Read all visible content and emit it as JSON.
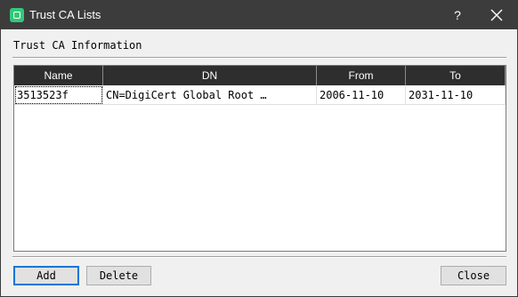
{
  "window": {
    "title": "Trust CA Lists",
    "help_label": "?"
  },
  "section": {
    "label": "Trust CA Information"
  },
  "table": {
    "columns": [
      "Name",
      "DN",
      "From",
      "To"
    ],
    "rows": [
      [
        "3513523f",
        "CN=DigiCert Global Root …",
        "2006-11-10",
        "2031-11-10"
      ]
    ]
  },
  "buttons": {
    "add": "Add",
    "delete": "Delete",
    "close": "Close"
  },
  "icons": {
    "app": "app-icon",
    "close": "close-icon"
  },
  "colors": {
    "titlebar": "#3c3c3c",
    "header": "#2e2e2e",
    "accent": "#0078d7",
    "app_icon": "#32c878"
  }
}
